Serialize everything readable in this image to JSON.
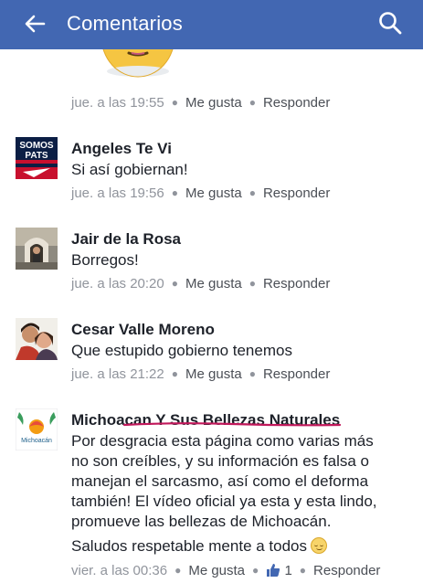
{
  "appbar": {
    "title": "Comentarios"
  },
  "comments": [
    {
      "time": "jue. a las 19:55",
      "like": "Me gusta",
      "reply": "Responder"
    },
    {
      "author": "Angeles Te Vi",
      "text": "Si así gobiernan!",
      "time": "jue. a las 19:56",
      "like": "Me gusta",
      "reply": "Responder",
      "avatar_text": [
        "SOMOS",
        "PATS"
      ]
    },
    {
      "author": "Jair de la Rosa",
      "text": "Borregos!",
      "time": "jue. a las 20:20",
      "like": "Me gusta",
      "reply": "Responder"
    },
    {
      "author": "Cesar Valle Moreno",
      "text": "Que estupido gobierno tenemos",
      "time": "jue. a las 21:22",
      "like": "Me gusta",
      "reply": "Responder"
    },
    {
      "author": "Michoacan Y Sus Bellezas Naturales",
      "avatar_text": "Michoacán",
      "lines": [
        "Por desgracia esta página como varias más",
        "no son creíbles, y su información es falsa o",
        "manejan el sarcasmo, así como el deforma",
        "también! El vídeo oficial ya esta y esta lindo,",
        "promueve las bellezas de Michoacán."
      ],
      "greeting": "Saludos respetable mente a todos",
      "time": "vier. a las 00:36",
      "like": "Me gusta",
      "reactions": "1",
      "reply": "Responder"
    }
  ],
  "colors": {
    "appbar": "#4267b2",
    "underline": "#c2185b",
    "meta": "#90949c"
  },
  "icons": {
    "back": "back-arrow-icon",
    "search": "search-icon",
    "thumb": "thumbs-up-icon",
    "emoji": "smile-emoji-icon"
  }
}
